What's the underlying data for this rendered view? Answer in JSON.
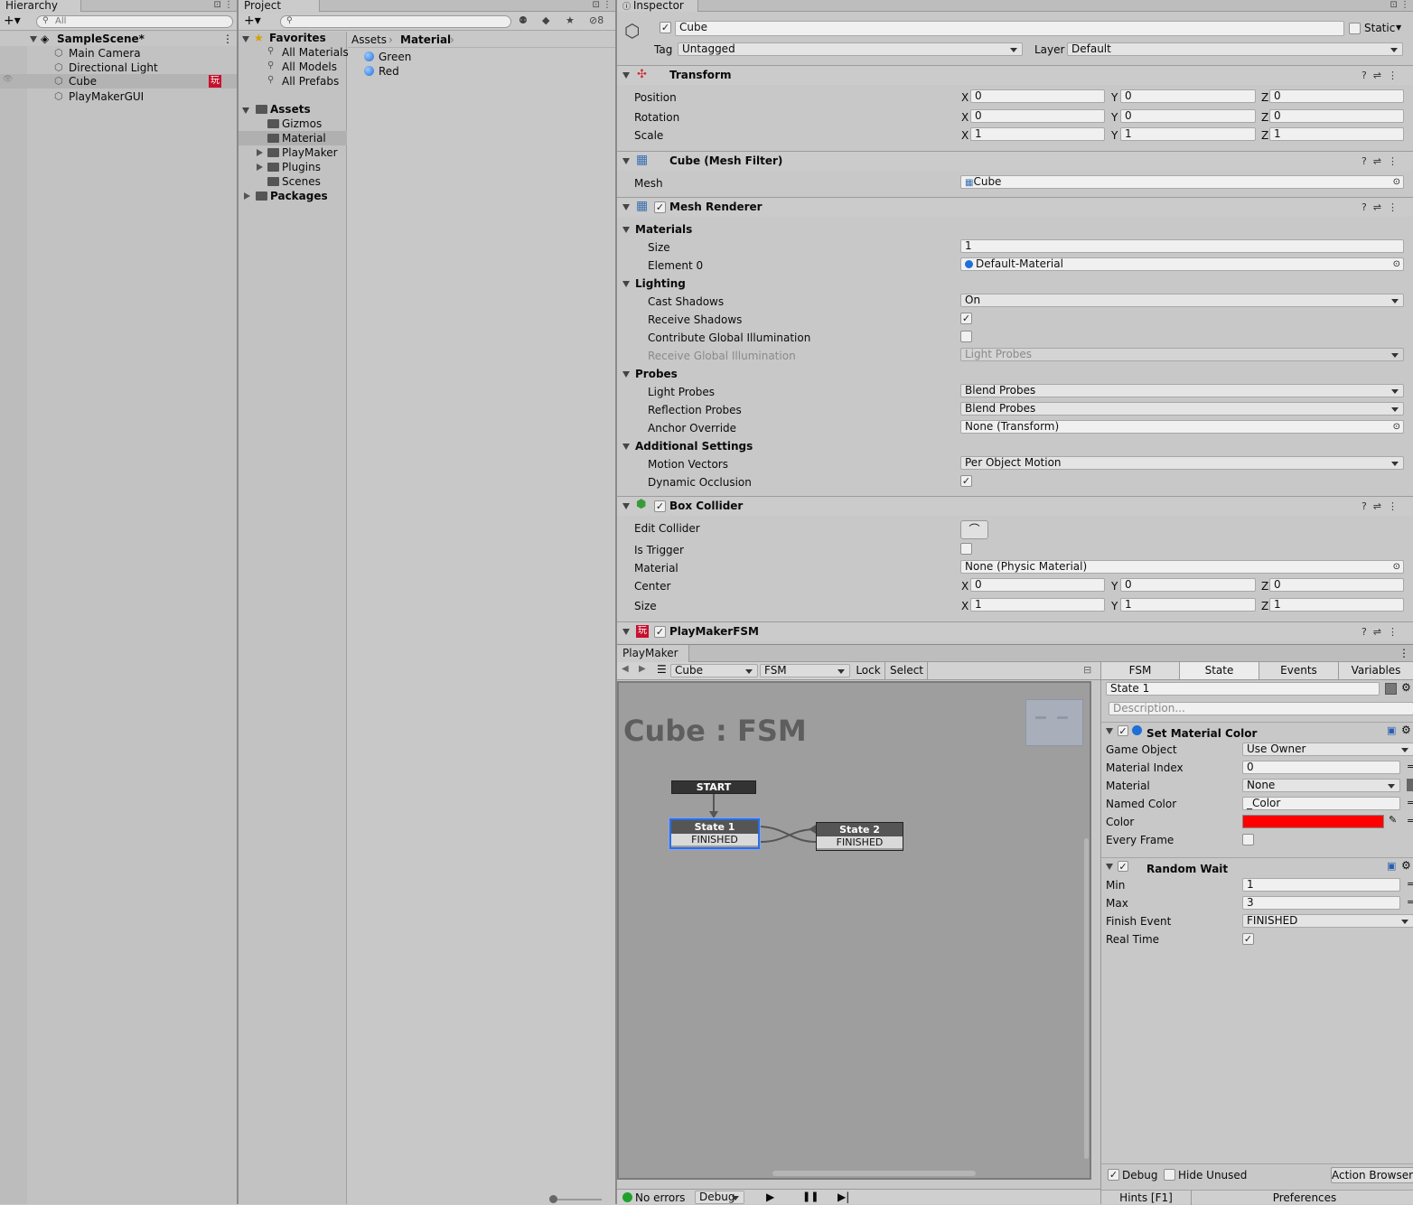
{
  "hierarchy": {
    "tab_title": "Hierarchy",
    "search_placeholder": "All",
    "scene": "SampleScene*",
    "items": [
      "Main Camera",
      "Directional Light",
      "Cube",
      "PlayMakerGUI"
    ],
    "playmaker_badge": "玩"
  },
  "project": {
    "tab_title": "Project",
    "hidden_count": "8",
    "favorites_label": "Favorites",
    "favorites": [
      "All Materials",
      "All Models",
      "All Prefabs"
    ],
    "assets_label": "Assets",
    "asset_folders": [
      "Gizmos",
      "Material",
      "PlayMaker",
      "Plugins",
      "Scenes"
    ],
    "packages_label": "Packages",
    "breadcrumb": [
      "Assets",
      "Material"
    ],
    "files": [
      "Green",
      "Red"
    ]
  },
  "inspector": {
    "tab_title": "Inspector",
    "object_name": "Cube",
    "static_label": "Static",
    "tag_label": "Tag",
    "tag_value": "Untagged",
    "layer_label": "Layer",
    "layer_value": "Default",
    "transform": {
      "title": "Transform",
      "rows": [
        {
          "label": "Position",
          "x": "0",
          "y": "0",
          "z": "0"
        },
        {
          "label": "Rotation",
          "x": "0",
          "y": "0",
          "z": "0"
        },
        {
          "label": "Scale",
          "x": "1",
          "y": "1",
          "z": "1"
        }
      ]
    },
    "mesh_filter": {
      "title": "Cube (Mesh Filter)",
      "mesh_label": "Mesh",
      "mesh_value": "Cube"
    },
    "mesh_renderer": {
      "title": "Mesh Renderer",
      "materials": "Materials",
      "size_label": "Size",
      "size_value": "1",
      "element0_label": "Element 0",
      "element0_value": "Default-Material",
      "lighting": "Lighting",
      "cast_shadows_label": "Cast Shadows",
      "cast_shadows_value": "On",
      "receive_shadows_label": "Receive Shadows",
      "contribute_gi_label": "Contribute Global Illumination",
      "receive_gi_label": "Receive Global Illumination",
      "receive_gi_value": "Light Probes",
      "probes": "Probes",
      "light_probes_label": "Light Probes",
      "light_probes_value": "Blend Probes",
      "reflection_probes_label": "Reflection Probes",
      "reflection_probes_value": "Blend Probes",
      "anchor_override_label": "Anchor Override",
      "anchor_override_value": "None (Transform)",
      "additional": "Additional Settings",
      "motion_vectors_label": "Motion Vectors",
      "motion_vectors_value": "Per Object Motion",
      "dynamic_occlusion_label": "Dynamic Occlusion"
    },
    "box_collider": {
      "title": "Box Collider",
      "edit_collider_label": "Edit Collider",
      "is_trigger_label": "Is Trigger",
      "material_label": "Material",
      "material_value": "None (Physic Material)",
      "center_label": "Center",
      "center": {
        "x": "0",
        "y": "0",
        "z": "0"
      },
      "size_label": "Size",
      "size": {
        "x": "1",
        "y": "1",
        "z": "1"
      }
    },
    "playmaker_fsm": {
      "title": "PlayMakerFSM"
    }
  },
  "axes": {
    "x": "X",
    "y": "Y",
    "z": "Z"
  },
  "playmaker": {
    "tab_title": "PlayMaker",
    "object_select": "Cube",
    "fsm_select": "FSM",
    "lock_label": "Lock",
    "select_label": "Select",
    "graph_title": "Cube : FSM",
    "start_label": "START",
    "state1": {
      "name": "State 1",
      "event": "FINISHED"
    },
    "state2": {
      "name": "State 2",
      "event": "FINISHED"
    },
    "tabs": [
      "FSM",
      "State",
      "Events",
      "Variables"
    ],
    "state_name": "State 1",
    "description_placeholder": "Description...",
    "action1": {
      "title": "Set Material Color",
      "rows": [
        {
          "label": "Game Object",
          "value": "Use Owner"
        },
        {
          "label": "Material Index",
          "value": "0"
        },
        {
          "label": "Material",
          "value": "None"
        },
        {
          "label": "Named Color",
          "value": "_Color"
        },
        {
          "label": "Color",
          "value": ""
        },
        {
          "label": "Every Frame",
          "value": ""
        }
      ],
      "color_value": "#ff0000"
    },
    "action2": {
      "title": "Random Wait",
      "rows": [
        {
          "label": "Min",
          "value": "1"
        },
        {
          "label": "Max",
          "value": "3"
        },
        {
          "label": "Finish Event",
          "value": "FINISHED"
        },
        {
          "label": "Real Time",
          "value": ""
        }
      ]
    },
    "debug_label": "Debug",
    "hide_unused_label": "Hide Unused",
    "action_browser_label": "Action Browser",
    "status_text": "No errors",
    "debug_dropdown": "Debug",
    "hints_label": "Hints [F1]",
    "preferences_label": "Preferences"
  }
}
